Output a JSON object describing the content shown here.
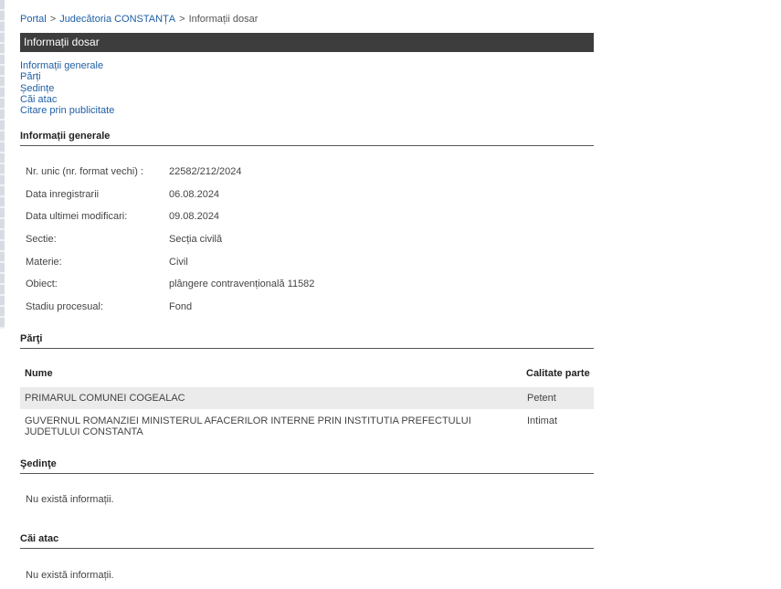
{
  "breadcrumb": {
    "portal": "Portal",
    "sep1": ">",
    "court": "Judecătoria CONSTANȚA",
    "sep2": ">",
    "current": "Informații dosar"
  },
  "page_title": "Informații dosar",
  "quick_links": [
    "Informații generale",
    "Părți",
    "Ședințe",
    "Căi atac",
    "Citare prin publicitate"
  ],
  "general": {
    "header": "Informații generale",
    "rows": [
      {
        "label": "Nr. unic (nr. format vechi) :",
        "value": "22582/212/2024"
      },
      {
        "label": "Data inregistrarii",
        "value": "06.08.2024"
      },
      {
        "label": "Data ultimei modificari:",
        "value": "09.08.2024"
      },
      {
        "label": "Sectie:",
        "value": "Secția civilă"
      },
      {
        "label": "Materie:",
        "value": "Civil"
      },
      {
        "label": "Obiect:",
        "value": "plângere contravențională 11582"
      },
      {
        "label": "Stadiu procesual:",
        "value": "Fond"
      }
    ]
  },
  "parti": {
    "header": "Părţi",
    "col_nume": "Nume",
    "col_calitate": "Calitate parte",
    "rows": [
      {
        "nume": "PRIMARUL COMUNEI COGEALAC",
        "calitate": "Petent"
      },
      {
        "nume": "GUVERNUL ROMANZIEI MINISTERUL AFACERILOR INTERNE PRIN INSTITUTIA PREFECTULUI JUDETULUI CONSTANTA",
        "calitate": "Intimat"
      }
    ]
  },
  "sedinte": {
    "header": "Şedinţe",
    "empty": "Nu există informații."
  },
  "cai_atac": {
    "header": "Căi atac",
    "empty": "Nu există informații."
  }
}
